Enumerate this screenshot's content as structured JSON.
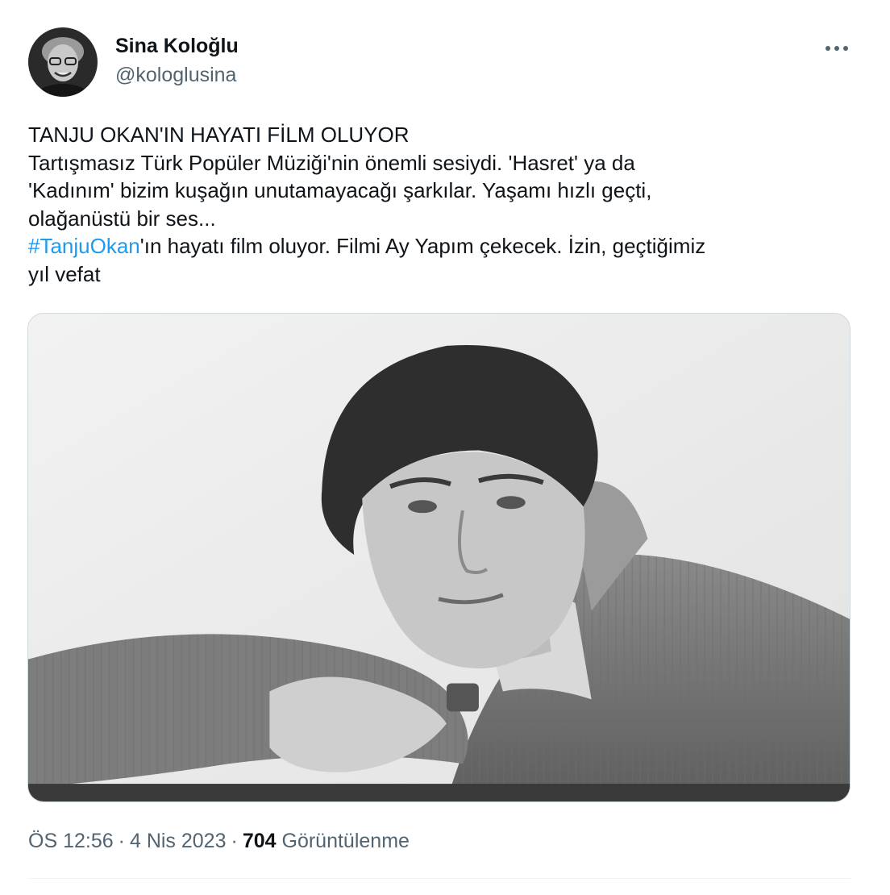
{
  "author": {
    "name": "Sina Koloğlu",
    "handle": "@kologlusina"
  },
  "tweet": {
    "headline": "TANJU OKAN'IN HAYATI FİLM OLUYOR",
    "body_lines": [
      "Tartışmasız Türk Popüler Müziği'nin önemli sesiydi. 'Hasret' ya da",
      "'Kadınım' bizim kuşağın unutamayacağı şarkılar. Yaşamı hızlı geçti,",
      "olağanüstü bir ses..."
    ],
    "hashtag": "#TanjuOkan",
    "after_hashtag": "'ın hayatı film oluyor. Filmi Ay Yapım çekecek. İzin, geçtiğimiz",
    "last_line": "yıl vefat"
  },
  "meta": {
    "time": "ÖS 12:56",
    "date": "4 Nis 2023",
    "views_count": "704",
    "views_label": "Görüntülenme",
    "separator": "·"
  },
  "icons": {
    "more": "more-dots-icon",
    "avatar": "avatar-photo",
    "media": "portrait-photo"
  },
  "colors": {
    "text": "#0f1419",
    "secondary": "#536471",
    "link": "#1d9bf0",
    "border": "#cfd9de"
  }
}
